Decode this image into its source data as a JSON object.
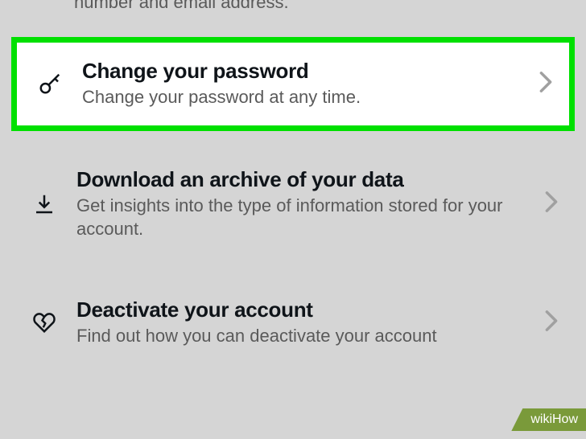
{
  "partialText": "number and email address.",
  "items": [
    {
      "title": "Change your password",
      "subtitle": "Change your password at any time."
    },
    {
      "title": "Download an archive of your data",
      "subtitle": "Get insights into the type of information stored for your account."
    },
    {
      "title": "Deactivate your account",
      "subtitle": "Find out how you can deactivate your account"
    }
  ],
  "watermark": "wikiHow"
}
